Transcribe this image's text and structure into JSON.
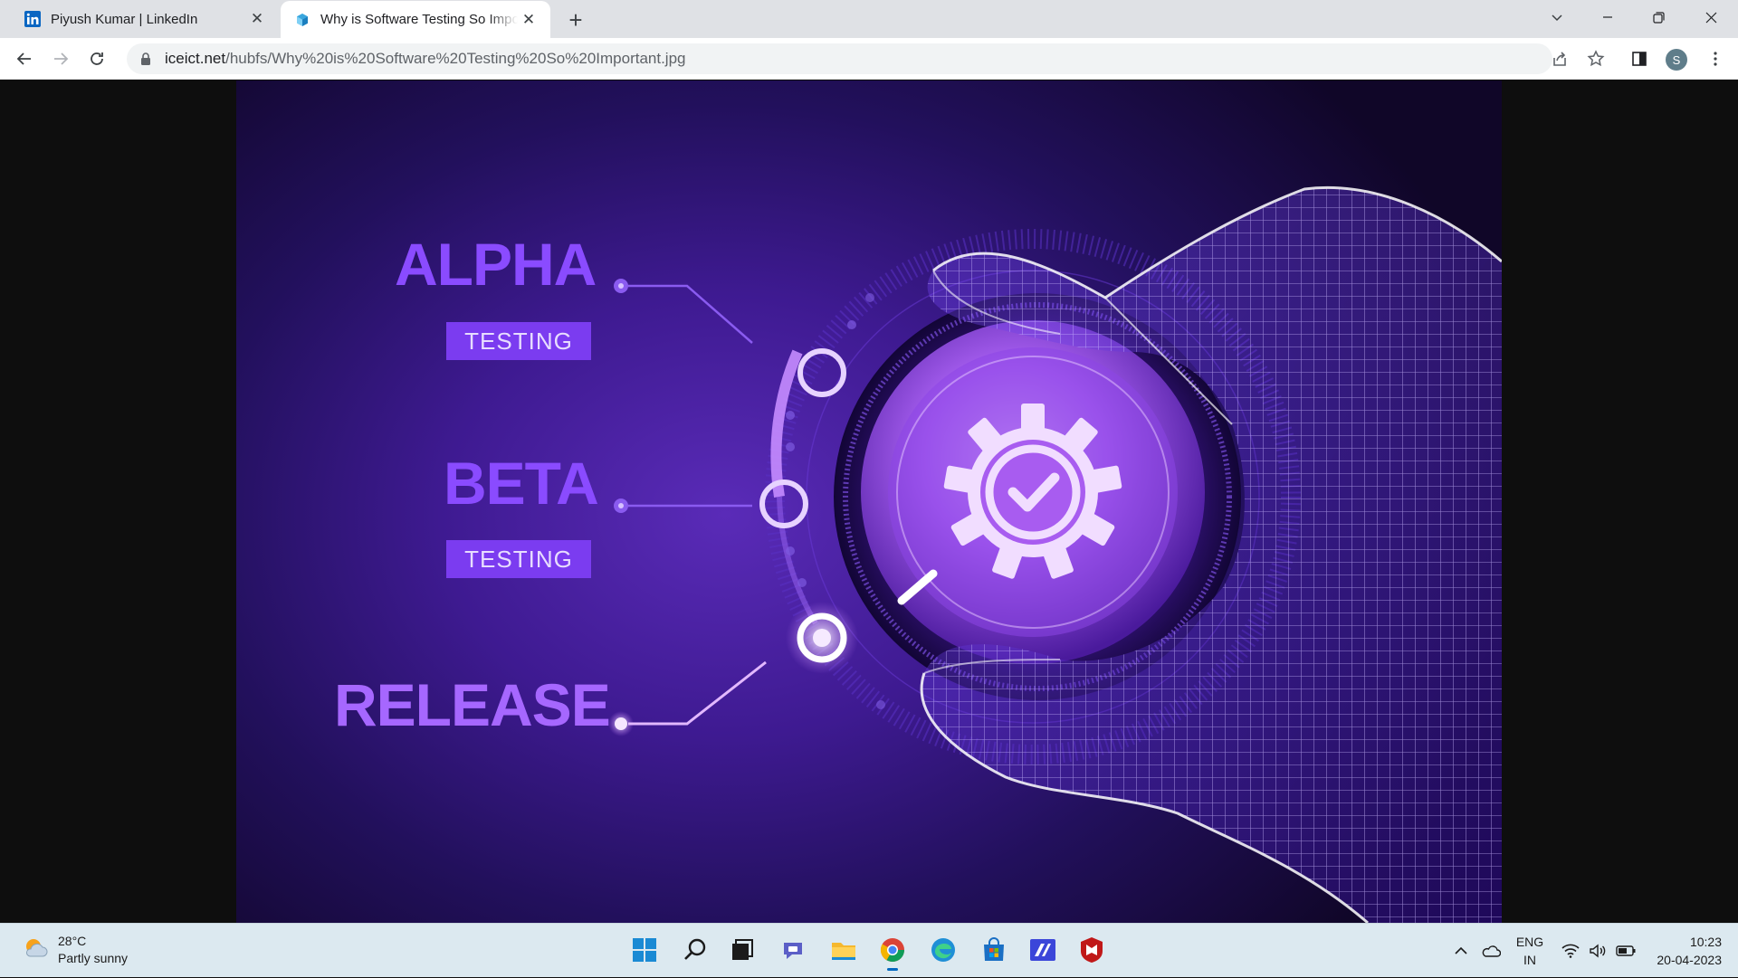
{
  "browser": {
    "tabs": [
      {
        "title": "Piyush Kumar | LinkedIn",
        "active": false,
        "favicon": "linkedin-icon"
      },
      {
        "title": "Why is Software Testing So Important",
        "active": true,
        "favicon": "hubspot-cube-icon"
      }
    ],
    "url_host": "iceict.net",
    "url_path": "/hubfs/Why%20is%20Software%20Testing%20So%20Important.jpg",
    "profile_initial": "S"
  },
  "image": {
    "labels": {
      "alpha_big": "ALPHA",
      "alpha_tag": "TESTING",
      "beta_big": "BETA",
      "beta_tag": "TESTING",
      "release_big": "RELEASE"
    },
    "colors": {
      "accent": "#8a4bff",
      "tag_bg": "#7b3cf0",
      "background": "#2a1270"
    }
  },
  "taskbar": {
    "weather_temp": "28°C",
    "weather_desc": "Partly sunny",
    "lang_top": "ENG",
    "lang_bottom": "IN",
    "time": "10:23",
    "date": "20-04-2023",
    "apps": [
      "windows-start-icon",
      "search-icon",
      "task-view-icon",
      "teams-chat-icon",
      "file-explorer-icon",
      "chrome-icon",
      "edge-icon",
      "microsoft-store-icon",
      "vpn-app-icon",
      "mcafee-icon"
    ]
  }
}
